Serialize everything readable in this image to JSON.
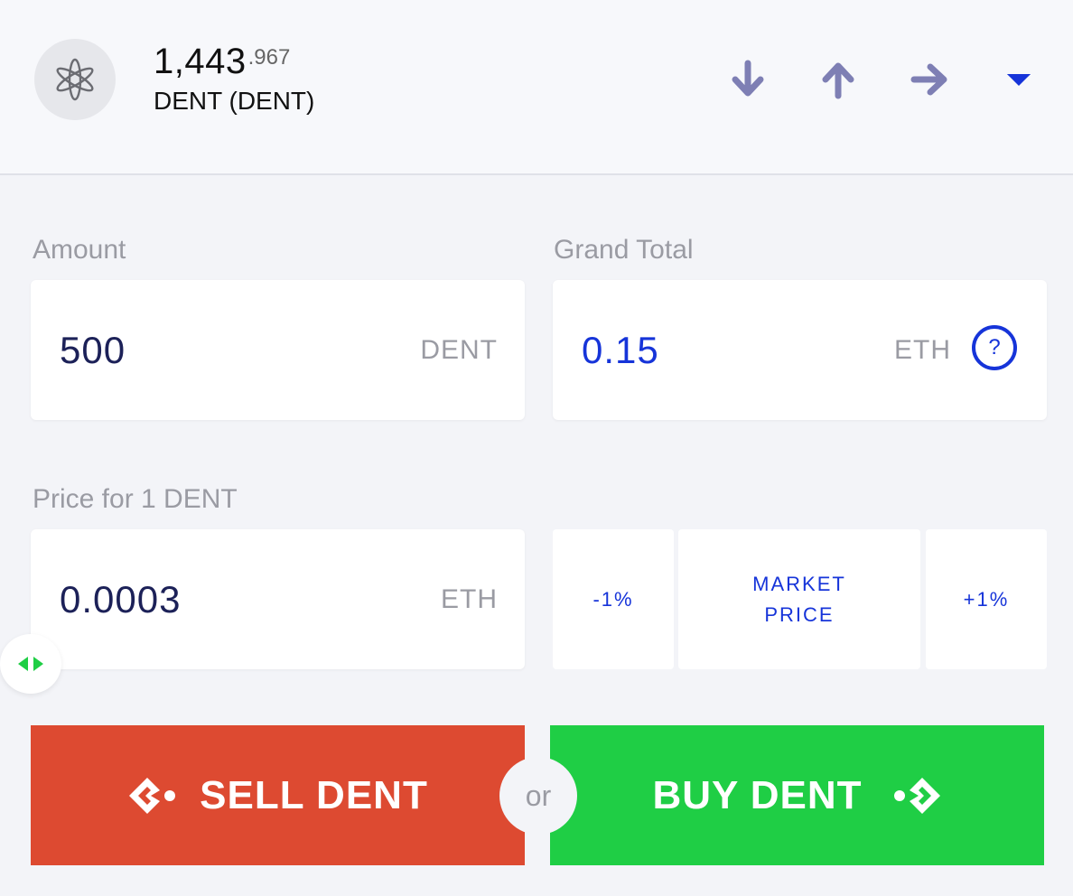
{
  "header": {
    "balance_int": "1,443",
    "balance_dec": ".967",
    "token_name": "DENT (DENT)",
    "icons": [
      "receive-arrow-down-icon",
      "send-arrow-up-icon",
      "transfer-arrow-right-icon",
      "dropdown-caret-icon"
    ]
  },
  "amount": {
    "label": "Amount",
    "value": "500",
    "unit": "DENT"
  },
  "grand_total": {
    "label": "Grand Total",
    "value": "0.15",
    "unit": "ETH",
    "help": "?"
  },
  "price": {
    "label": "Price for 1 DENT",
    "value": "0.0003",
    "unit": "ETH"
  },
  "price_adjust": {
    "minus": "-1%",
    "market_line1": "MARKET",
    "market_line2": "PRICE",
    "plus": "+1%"
  },
  "actions": {
    "sell": "SELL DENT",
    "or": "or",
    "buy": "BUY DENT"
  },
  "colors": {
    "accent": "#1634d9",
    "sell": "#dd4a31",
    "buy": "#1fce45",
    "icon": "#7e7fb4"
  }
}
